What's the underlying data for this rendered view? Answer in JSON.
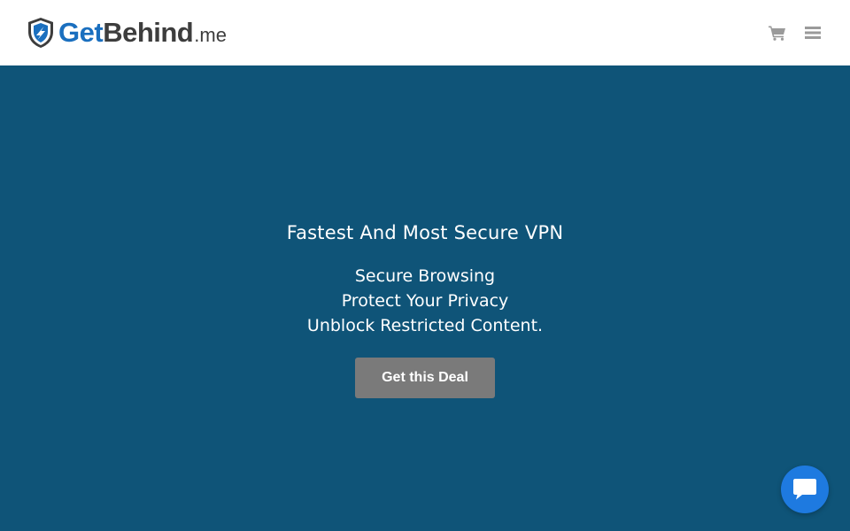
{
  "header": {
    "logo": {
      "part1": "Get",
      "part2": "Behind",
      "part3": ".me"
    },
    "icons": {
      "cart": "cart-icon",
      "menu": "hamburger-menu-icon"
    }
  },
  "hero": {
    "title": "Fastest And Most Secure VPN",
    "lines": [
      "Secure Browsing",
      "Protect Your Privacy",
      "Unblock Restricted Content."
    ],
    "cta_label": "Get this Deal"
  },
  "chat": {
    "icon": "chat-icon"
  },
  "colors": {
    "hero_bg": "#0f5478",
    "brand_blue": "#1a6fbf",
    "cta_bg": "#7a7a7a",
    "chat_bg": "#1e7ae0"
  }
}
